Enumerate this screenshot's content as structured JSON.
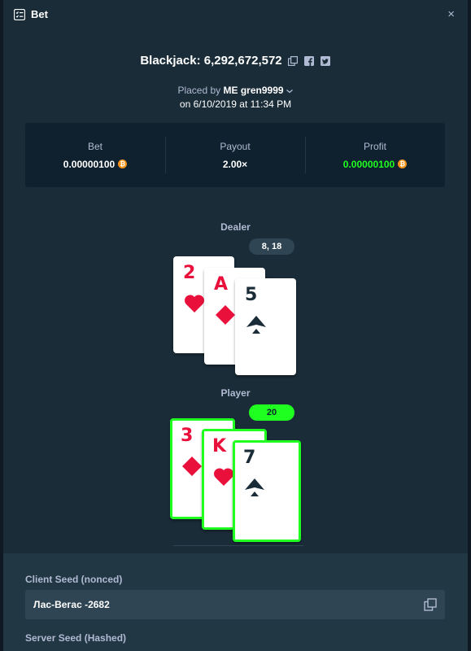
{
  "header": {
    "title": "Bet",
    "close_glyph": "×"
  },
  "game": {
    "title": "Blackjack: 6,292,672,572"
  },
  "placed": {
    "prefix": "Placed by",
    "user_badge": "ME",
    "username": "gren9999",
    "date": "on 6/10/2019 at 11:34 PM"
  },
  "stats": {
    "bet": {
      "label": "Bet",
      "value": "0.00000100"
    },
    "payout": {
      "label": "Payout",
      "value": "2.00×"
    },
    "profit": {
      "label": "Profit",
      "value": "0.00000100"
    }
  },
  "dealer": {
    "label": "Dealer",
    "total": "8, 18",
    "cards": [
      {
        "rank": "2",
        "suit": "hearts"
      },
      {
        "rank": "A",
        "suit": "diamonds"
      },
      {
        "rank": "5",
        "suit": "spades"
      }
    ]
  },
  "player": {
    "label": "Player",
    "total": "20",
    "cards": [
      {
        "rank": "3",
        "suit": "diamonds"
      },
      {
        "rank": "K",
        "suit": "hearts"
      },
      {
        "rank": "7",
        "suit": "spades"
      }
    ]
  },
  "seeds": {
    "client_label": "Client Seed (nonced)",
    "client_value": "Лас-Вегас -2682",
    "server_label": "Server Seed (Hashed)"
  },
  "colors": {
    "bg": "#1a2c38",
    "panel": "#0f212e",
    "green": "#1fff20",
    "red": "#e9113c",
    "btc": "#f7931a"
  },
  "icons": {
    "header": "list-check-icon",
    "copy": "copy-icon",
    "facebook": "facebook-icon",
    "twitter": "twitter-icon",
    "coin": "bitcoin-icon",
    "close": "close-icon"
  }
}
